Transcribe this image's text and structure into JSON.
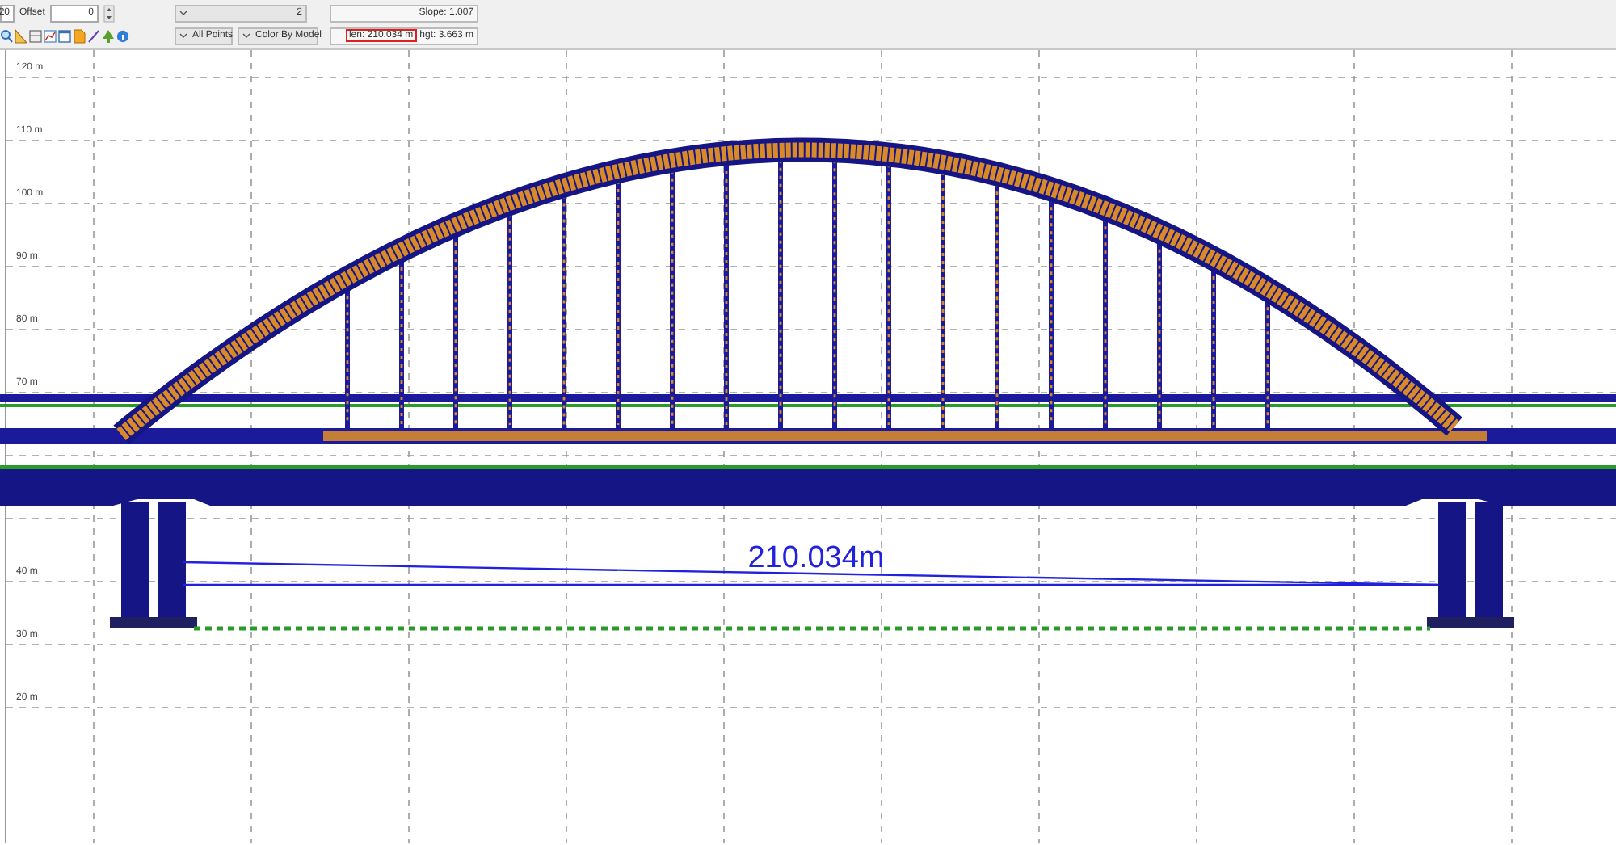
{
  "toolbar": {
    "clipped_field": "20",
    "offset_label": "Offset",
    "offset_value": "0",
    "combo_value": "2",
    "slope": "Slope: 1.007",
    "filter": "All Points",
    "color_mode": "Color By Model",
    "length": "len: 210.034 m",
    "length_highlighted": true,
    "height": "hgt: 3.663 m"
  },
  "plot": {
    "y_labels": [
      "120 m",
      "110 m",
      "100 m",
      "90 m",
      "80 m",
      "70 m",
      "40 m",
      "30 m",
      "20 m"
    ],
    "measurement": "210.034m"
  }
}
